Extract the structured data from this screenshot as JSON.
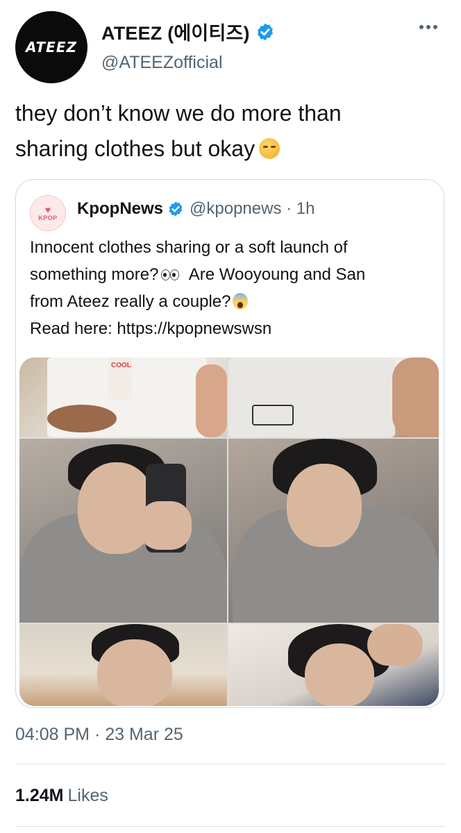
{
  "tweet": {
    "avatar_text": "ATEEZ",
    "display_name": "ATEEZ (에이티즈)",
    "handle": "@ATEEZofficial",
    "text_line1": "they don’t know we do more than",
    "text_line2": "sharing clothes but okay",
    "emoji_icon": "unamused-face-emoji",
    "timestamp": "04:08 PM · 23 Mar 25",
    "likes_count": "1.24M",
    "likes_label": "Likes"
  },
  "quoted": {
    "avatar_text": "KPOP",
    "name": "KpopNews",
    "handle_time": "@kpopnews · 1h",
    "line1": "Innocent clothes sharing or a soft launch of",
    "line2_a": "something more?",
    "line2_b": "Are Wooyoung and San",
    "line3": "from Ateez really a couple?",
    "line4": "Read here: https://kpopnewswsn",
    "photo_text_cup": "COOL"
  },
  "colors": {
    "verified_blue": "#1d9bf0",
    "secondary_text": "#536471",
    "border": "#cfd9de"
  }
}
